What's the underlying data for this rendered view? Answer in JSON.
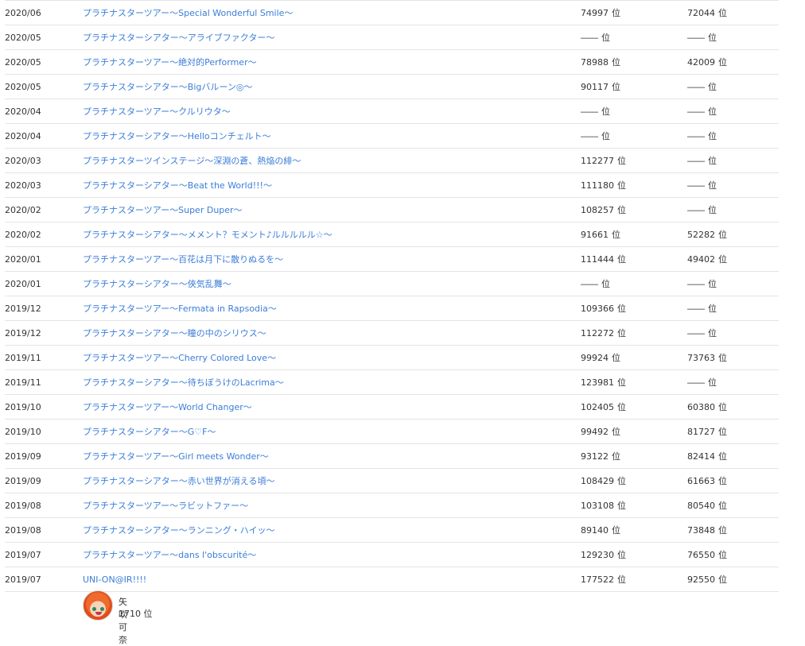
{
  "rows": [
    {
      "date": "2020/06",
      "name": "プラチナスターツアー～Special Wonderful Smile～",
      "rank1": "74997",
      "rank2": "72044"
    },
    {
      "date": "2020/05",
      "name": "プラチナスターシアター～アライブファクター～",
      "rank1": "――",
      "rank2": "――"
    },
    {
      "date": "2020/05",
      "name": "プラチナスターツアー～絶対的Performer～",
      "rank1": "78988",
      "rank2": "42009"
    },
    {
      "date": "2020/05",
      "name": "プラチナスターシアター～Bigバルーン◎～",
      "rank1": "90117",
      "rank2": "――"
    },
    {
      "date": "2020/04",
      "name": "プラチナスターツアー～クルリウタ～",
      "rank1": "――",
      "rank2": "――"
    },
    {
      "date": "2020/04",
      "name": "プラチナスターシアター～Helloコンチェルト～",
      "rank1": "――",
      "rank2": "――"
    },
    {
      "date": "2020/03",
      "name": "プラチナスターツインステージ～深淵の蒼、熱焔の緋～",
      "rank1": "112277",
      "rank2": "――"
    },
    {
      "date": "2020/03",
      "name": "プラチナスターシアター～Beat the World!!!～",
      "rank1": "111180",
      "rank2": "――"
    },
    {
      "date": "2020/02",
      "name": "プラチナスターツアー～Super Duper～",
      "rank1": "108257",
      "rank2": "――"
    },
    {
      "date": "2020/02",
      "name": "プラチナスターシアター～メメント？モメント♪ルルルルル☆～",
      "rank1": "91661",
      "rank2": "52282"
    },
    {
      "date": "2020/01",
      "name": "プラチナスターツアー～百花は月下に散りぬるを～",
      "rank1": "111444",
      "rank2": "49402"
    },
    {
      "date": "2020/01",
      "name": "プラチナスターシアター～俠気乱舞～",
      "rank1": "――",
      "rank2": "――"
    },
    {
      "date": "2019/12",
      "name": "プラチナスターツアー～Fermata in Rapsodia～",
      "rank1": "109366",
      "rank2": "――"
    },
    {
      "date": "2019/12",
      "name": "プラチナスターシアター～瞳の中のシリウス～",
      "rank1": "112272",
      "rank2": "――"
    },
    {
      "date": "2019/11",
      "name": "プラチナスターツアー～Cherry Colored Love～",
      "rank1": "99924",
      "rank2": "73763"
    },
    {
      "date": "2019/11",
      "name": "プラチナスターシアター～待ちぼうけのLacrima～",
      "rank1": "123981",
      "rank2": "――"
    },
    {
      "date": "2019/10",
      "name": "プラチナスターツアー～World Changer～",
      "rank1": "102405",
      "rank2": "60380"
    },
    {
      "date": "2019/10",
      "name": "プラチナスターシアター～G♡F～",
      "rank1": "99492",
      "rank2": "81727"
    },
    {
      "date": "2019/09",
      "name": "プラチナスターツアー～Girl meets Wonder～",
      "rank1": "93122",
      "rank2": "82414"
    },
    {
      "date": "2019/09",
      "name": "プラチナスターシアター～赤い世界が消える頃～",
      "rank1": "108429",
      "rank2": "61663"
    },
    {
      "date": "2019/08",
      "name": "プラチナスターツアー～ラビットファー～",
      "rank1": "103108",
      "rank2": "80540"
    },
    {
      "date": "2019/08",
      "name": "プラチナスターシアター～ランニング・ハイッ～",
      "rank1": "89140",
      "rank2": "73848"
    },
    {
      "date": "2019/07",
      "name": "プラチナスターツアー～dans l'obscurité～",
      "rank1": "129230",
      "rank2": "76550"
    },
    {
      "date": "2019/07",
      "name": "UNI-ON@IR!!!!",
      "rank1": "177522",
      "rank2": "92550"
    }
  ],
  "rank_unit": "位",
  "profile": {
    "name": "矢吹可奈",
    "rank": "1710",
    "rank_unit": "位",
    "avatar_icon": "character-avatar-icon"
  },
  "colors": {
    "link": "#3b7dd8",
    "border": "#e4e4e4",
    "text": "#333333"
  }
}
